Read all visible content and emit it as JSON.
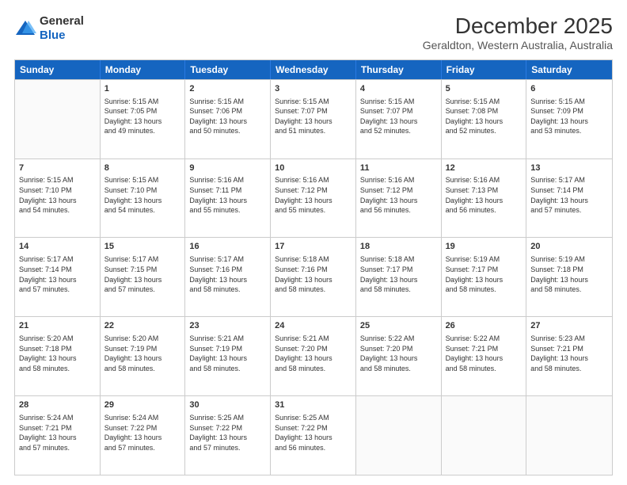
{
  "logo": {
    "general": "General",
    "blue": "Blue"
  },
  "header": {
    "title": "December 2025",
    "subtitle": "Geraldton, Western Australia, Australia"
  },
  "weekdays": [
    "Sunday",
    "Monday",
    "Tuesday",
    "Wednesday",
    "Thursday",
    "Friday",
    "Saturday"
  ],
  "weeks": [
    [
      {
        "day": "",
        "lines": []
      },
      {
        "day": "1",
        "lines": [
          "Sunrise: 5:15 AM",
          "Sunset: 7:05 PM",
          "Daylight: 13 hours",
          "and 49 minutes."
        ]
      },
      {
        "day": "2",
        "lines": [
          "Sunrise: 5:15 AM",
          "Sunset: 7:06 PM",
          "Daylight: 13 hours",
          "and 50 minutes."
        ]
      },
      {
        "day": "3",
        "lines": [
          "Sunrise: 5:15 AM",
          "Sunset: 7:07 PM",
          "Daylight: 13 hours",
          "and 51 minutes."
        ]
      },
      {
        "day": "4",
        "lines": [
          "Sunrise: 5:15 AM",
          "Sunset: 7:07 PM",
          "Daylight: 13 hours",
          "and 52 minutes."
        ]
      },
      {
        "day": "5",
        "lines": [
          "Sunrise: 5:15 AM",
          "Sunset: 7:08 PM",
          "Daylight: 13 hours",
          "and 52 minutes."
        ]
      },
      {
        "day": "6",
        "lines": [
          "Sunrise: 5:15 AM",
          "Sunset: 7:09 PM",
          "Daylight: 13 hours",
          "and 53 minutes."
        ]
      }
    ],
    [
      {
        "day": "7",
        "lines": [
          "Sunrise: 5:15 AM",
          "Sunset: 7:10 PM",
          "Daylight: 13 hours",
          "and 54 minutes."
        ]
      },
      {
        "day": "8",
        "lines": [
          "Sunrise: 5:15 AM",
          "Sunset: 7:10 PM",
          "Daylight: 13 hours",
          "and 54 minutes."
        ]
      },
      {
        "day": "9",
        "lines": [
          "Sunrise: 5:16 AM",
          "Sunset: 7:11 PM",
          "Daylight: 13 hours",
          "and 55 minutes."
        ]
      },
      {
        "day": "10",
        "lines": [
          "Sunrise: 5:16 AM",
          "Sunset: 7:12 PM",
          "Daylight: 13 hours",
          "and 55 minutes."
        ]
      },
      {
        "day": "11",
        "lines": [
          "Sunrise: 5:16 AM",
          "Sunset: 7:12 PM",
          "Daylight: 13 hours",
          "and 56 minutes."
        ]
      },
      {
        "day": "12",
        "lines": [
          "Sunrise: 5:16 AM",
          "Sunset: 7:13 PM",
          "Daylight: 13 hours",
          "and 56 minutes."
        ]
      },
      {
        "day": "13",
        "lines": [
          "Sunrise: 5:17 AM",
          "Sunset: 7:14 PM",
          "Daylight: 13 hours",
          "and 57 minutes."
        ]
      }
    ],
    [
      {
        "day": "14",
        "lines": [
          "Sunrise: 5:17 AM",
          "Sunset: 7:14 PM",
          "Daylight: 13 hours",
          "and 57 minutes."
        ]
      },
      {
        "day": "15",
        "lines": [
          "Sunrise: 5:17 AM",
          "Sunset: 7:15 PM",
          "Daylight: 13 hours",
          "and 57 minutes."
        ]
      },
      {
        "day": "16",
        "lines": [
          "Sunrise: 5:17 AM",
          "Sunset: 7:16 PM",
          "Daylight: 13 hours",
          "and 58 minutes."
        ]
      },
      {
        "day": "17",
        "lines": [
          "Sunrise: 5:18 AM",
          "Sunset: 7:16 PM",
          "Daylight: 13 hours",
          "and 58 minutes."
        ]
      },
      {
        "day": "18",
        "lines": [
          "Sunrise: 5:18 AM",
          "Sunset: 7:17 PM",
          "Daylight: 13 hours",
          "and 58 minutes."
        ]
      },
      {
        "day": "19",
        "lines": [
          "Sunrise: 5:19 AM",
          "Sunset: 7:17 PM",
          "Daylight: 13 hours",
          "and 58 minutes."
        ]
      },
      {
        "day": "20",
        "lines": [
          "Sunrise: 5:19 AM",
          "Sunset: 7:18 PM",
          "Daylight: 13 hours",
          "and 58 minutes."
        ]
      }
    ],
    [
      {
        "day": "21",
        "lines": [
          "Sunrise: 5:20 AM",
          "Sunset: 7:18 PM",
          "Daylight: 13 hours",
          "and 58 minutes."
        ]
      },
      {
        "day": "22",
        "lines": [
          "Sunrise: 5:20 AM",
          "Sunset: 7:19 PM",
          "Daylight: 13 hours",
          "and 58 minutes."
        ]
      },
      {
        "day": "23",
        "lines": [
          "Sunrise: 5:21 AM",
          "Sunset: 7:19 PM",
          "Daylight: 13 hours",
          "and 58 minutes."
        ]
      },
      {
        "day": "24",
        "lines": [
          "Sunrise: 5:21 AM",
          "Sunset: 7:20 PM",
          "Daylight: 13 hours",
          "and 58 minutes."
        ]
      },
      {
        "day": "25",
        "lines": [
          "Sunrise: 5:22 AM",
          "Sunset: 7:20 PM",
          "Daylight: 13 hours",
          "and 58 minutes."
        ]
      },
      {
        "day": "26",
        "lines": [
          "Sunrise: 5:22 AM",
          "Sunset: 7:21 PM",
          "Daylight: 13 hours",
          "and 58 minutes."
        ]
      },
      {
        "day": "27",
        "lines": [
          "Sunrise: 5:23 AM",
          "Sunset: 7:21 PM",
          "Daylight: 13 hours",
          "and 58 minutes."
        ]
      }
    ],
    [
      {
        "day": "28",
        "lines": [
          "Sunrise: 5:24 AM",
          "Sunset: 7:21 PM",
          "Daylight: 13 hours",
          "and 57 minutes."
        ]
      },
      {
        "day": "29",
        "lines": [
          "Sunrise: 5:24 AM",
          "Sunset: 7:22 PM",
          "Daylight: 13 hours",
          "and 57 minutes."
        ]
      },
      {
        "day": "30",
        "lines": [
          "Sunrise: 5:25 AM",
          "Sunset: 7:22 PM",
          "Daylight: 13 hours",
          "and 57 minutes."
        ]
      },
      {
        "day": "31",
        "lines": [
          "Sunrise: 5:25 AM",
          "Sunset: 7:22 PM",
          "Daylight: 13 hours",
          "and 56 minutes."
        ]
      },
      {
        "day": "",
        "lines": []
      },
      {
        "day": "",
        "lines": []
      },
      {
        "day": "",
        "lines": []
      }
    ]
  ]
}
